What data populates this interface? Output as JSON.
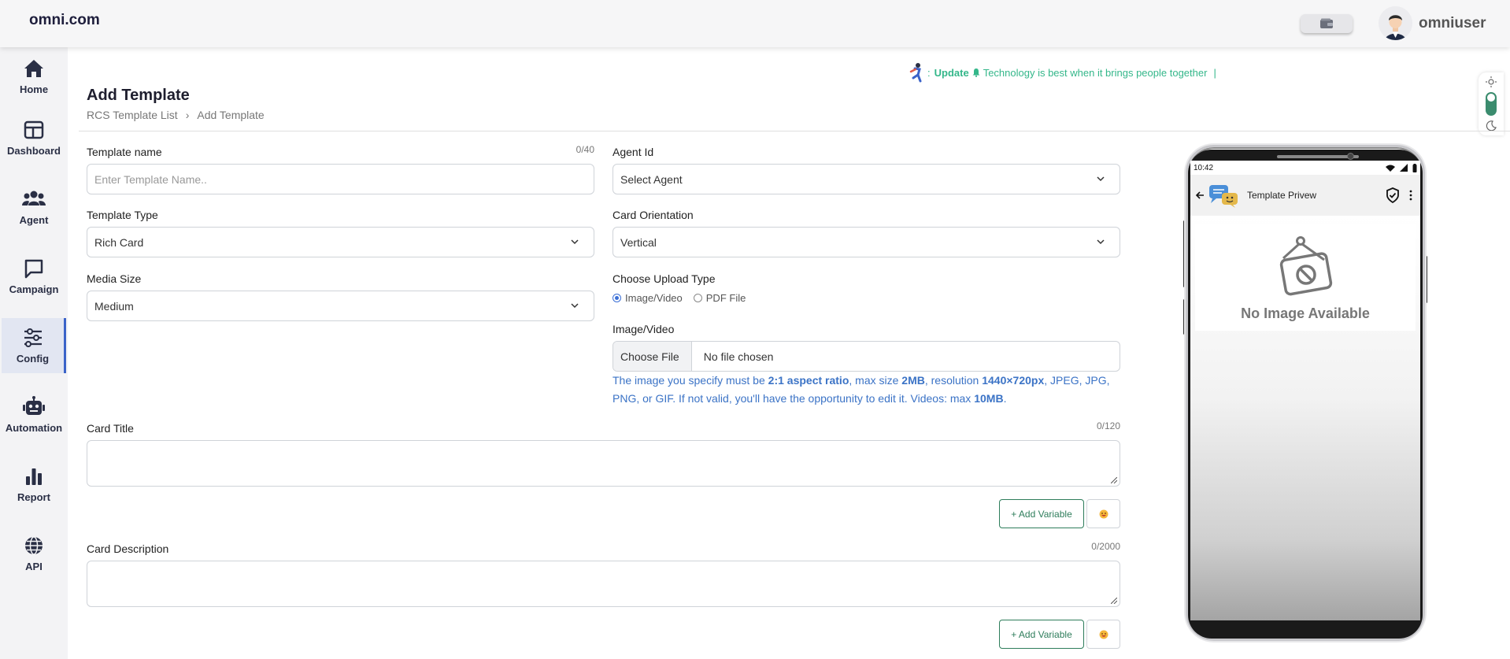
{
  "header": {
    "logo": "omni.com",
    "username": "omniuser",
    "wallet_icon": "wallet-icon",
    "avatar_icon": "user-avatar-icon"
  },
  "sidebar": {
    "items": [
      {
        "label": "Home",
        "icon": "home-icon"
      },
      {
        "label": "Dashboard",
        "icon": "dashboard-icon"
      },
      {
        "label": "Agent",
        "icon": "users-icon"
      },
      {
        "label": "Campaign",
        "icon": "chat-icon"
      },
      {
        "label": "Config",
        "icon": "sliders-icon",
        "active": true
      },
      {
        "label": "Automation",
        "icon": "robot-icon"
      },
      {
        "label": "Report",
        "icon": "bar-chart-icon"
      },
      {
        "label": "API",
        "icon": "globe-icon"
      }
    ]
  },
  "ticker": {
    "prefix": ":",
    "update_label": "Update",
    "message": "Technology is best when it brings people together",
    "cursor": "|"
  },
  "page": {
    "title": "Add Template",
    "breadcrumb": [
      "RCS Template List",
      "Add Template"
    ],
    "breadcrumb_separator": "›"
  },
  "form": {
    "template_name": {
      "label": "Template name",
      "placeholder": "Enter Template Name..",
      "counter": "0/40"
    },
    "agent_id": {
      "label": "Agent Id",
      "value": "Select Agent"
    },
    "template_type": {
      "label": "Template Type",
      "value": "Rich Card"
    },
    "card_orientation": {
      "label": "Card Orientation",
      "value": "Vertical"
    },
    "media_size": {
      "label": "Media Size",
      "value": "Medium"
    },
    "upload_type": {
      "label": "Choose Upload Type",
      "options": [
        "Image/Video",
        "PDF File"
      ],
      "selected": "Image/Video"
    },
    "image_video": {
      "label": "Image/Video",
      "button": "Choose File",
      "file_name": "No file chosen",
      "hint": {
        "t1": "The image you specify must be ",
        "b1": "2:1 aspect ratio",
        "t2": ", max size ",
        "b2": "2MB",
        "t3": ", resolution ",
        "b3": "1440×720px",
        "t4": ", JPEG, JPG, PNG, or GIF. If not valid, you'll have the opportunity to edit it. Videos: max ",
        "b4": "10MB",
        "t5": "."
      }
    },
    "card_title": {
      "label": "Card Title",
      "counter": "0/120",
      "add_variable": "+ Add Variable"
    },
    "card_description": {
      "label": "Card Description",
      "counter": "0/2000",
      "add_variable": "+ Add Variable"
    }
  },
  "preview": {
    "time": "10:42",
    "title": "Template Privew",
    "no_image": "No Image Available"
  },
  "colors": {
    "accent_green": "#2e7d5b",
    "ticker_green": "#34b78a",
    "hint_blue": "#3b73c6",
    "active_nav": "#3b63c9"
  }
}
